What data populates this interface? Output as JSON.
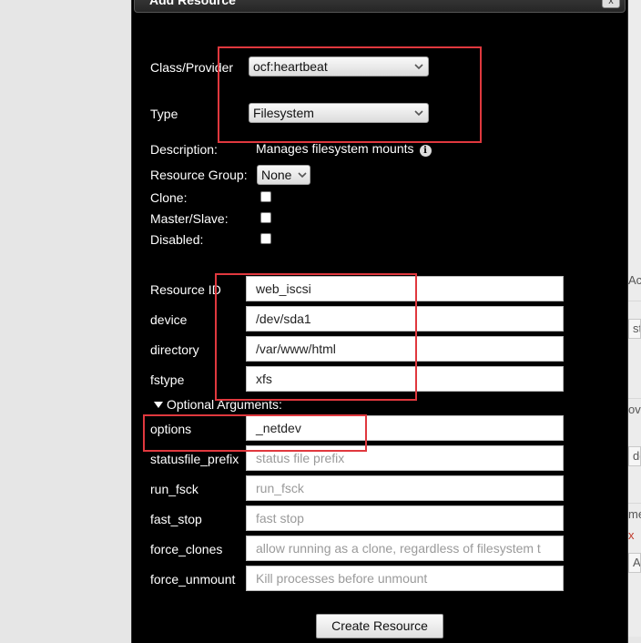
{
  "dialog": {
    "title": "Add Resource",
    "close_label": "x"
  },
  "form": {
    "class_provider": {
      "label": "Class/Provider",
      "value": "ocf:heartbeat"
    },
    "type": {
      "label": "Type",
      "value": "Filesystem"
    },
    "description": {
      "label": "Description:",
      "value": "Manages filesystem mounts"
    },
    "resource_group": {
      "label": "Resource Group:",
      "value": "None"
    },
    "clone": {
      "label": "Clone:"
    },
    "master_slave": {
      "label": "Master/Slave:"
    },
    "disabled": {
      "label": "Disabled:"
    },
    "resource_id": {
      "label": "Resource ID",
      "value": "web_iscsi"
    },
    "device": {
      "label": "device",
      "value": "/dev/sda1"
    },
    "directory": {
      "label": "directory",
      "value": "/var/www/html"
    },
    "fstype": {
      "label": "fstype",
      "value": "xfs"
    },
    "optional_arguments_label": "Optional Arguments:",
    "options": {
      "label": "options",
      "value": "_netdev"
    },
    "statusfile_prefix": {
      "label": "statusfile_prefix",
      "placeholder": "status file prefix"
    },
    "run_fsck": {
      "label": "run_fsck",
      "placeholder": "run_fsck"
    },
    "fast_stop": {
      "label": "fast_stop",
      "placeholder": "fast stop"
    },
    "force_clones": {
      "label": "force_clones",
      "placeholder": "allow running as a clone, regardless of filesystem t"
    },
    "force_unmount": {
      "label": "force_unmount",
      "placeholder": "Kill processes before unmount"
    },
    "create_label": "Create Resource"
  },
  "background": {
    "frag_1": "Ac",
    "frag_2": "st",
    "frag_3": "ov",
    "frag_4": "dd",
    "frag_5": "me",
    "frag_6": "x",
    "frag_7": "Ad"
  },
  "colors": {
    "dialog_bg": "#000000",
    "annotation_red": "#e0383e"
  }
}
